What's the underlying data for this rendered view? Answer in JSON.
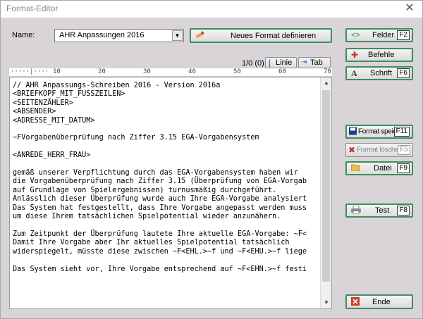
{
  "window": {
    "title": "Format-Editor",
    "close_glyph": "✕"
  },
  "name_field": {
    "label": "Name:",
    "value": "AHR Anpassungen 2016",
    "arrow": "▼"
  },
  "new_format_button": {
    "label": "Neues Format definieren",
    "icon": "pencil-icon"
  },
  "nav": {
    "status": "1/0 (0)",
    "line_button": "Linie",
    "tab_button": "Tab"
  },
  "ruler": [
    "10",
    "20",
    "30",
    "40",
    "50",
    "60",
    "70"
  ],
  "editor": {
    "lines": [
      "// AHR Anpassungs-Schreiben 2016 - Version 2016a",
      "<BRIEFKOPF_MIT_FUSSZEILEN>",
      "<SEITENZÄHLER>",
      "<ABSENDER>",
      "<ADRESSE_MIT_DATUM>",
      "",
      "~FVorgabenüberprüfung nach Ziffer 3.15 EGA-Vorgabensystem",
      "",
      "<ANREDE_HERR_FRAU>",
      "",
      "gemäß unserer Verpflichtung durch das EGA-Vorgabensystem haben wir",
      "die Vorgabenüberprüfung nach Ziffer 3.15 (Überprüfung von EGA-Vorgab",
      "auf Grundlage von Spielergebnissen) turnusmäßig durchgeführt.",
      "Anlässlich dieser Überprüfung wurde auch Ihre EGA-Vorgabe analysiert",
      "Das System hat festgestellt, dass Ihre Vorgabe angepasst werden muss",
      "um diese Ihrem tatsächlichen Spielpotential wieder anzunähern.",
      "",
      "Zum Zeitpunkt der Überprüfung lautete Ihre aktuelle EGA-Vorgabe: ~F<",
      "Damit Ihre Vorgabe aber Ihr aktuelles Spielpotential tatsächlich",
      "widerspiegelt, müsste diese zwischen ~F<EHL.>~f und ~F<EHU.>~f liege",
      "",
      "Das System sieht vor, Ihre Vorgabe entsprechend auf ~F<EHN.>~f festi"
    ]
  },
  "side_buttons": {
    "felder": {
      "label": "Felder",
      "key": "F2"
    },
    "befehle": {
      "label": "Befehle"
    },
    "schrift": {
      "label": "Schrift",
      "key": "F6"
    },
    "format_speichern": {
      "label": "Format speichern",
      "key": "F11"
    },
    "format_loeschen": {
      "label": "Format löschen",
      "key": "F5"
    },
    "datei": {
      "label": "Datei",
      "key": "F9"
    },
    "test": {
      "label": "Test",
      "key": "F8"
    },
    "ende": {
      "label": "Ende"
    }
  },
  "colors": {
    "window_bg": "#d9d4d7",
    "accent_green": "#3c8f5d",
    "delete_red": "#cc2b2b"
  }
}
